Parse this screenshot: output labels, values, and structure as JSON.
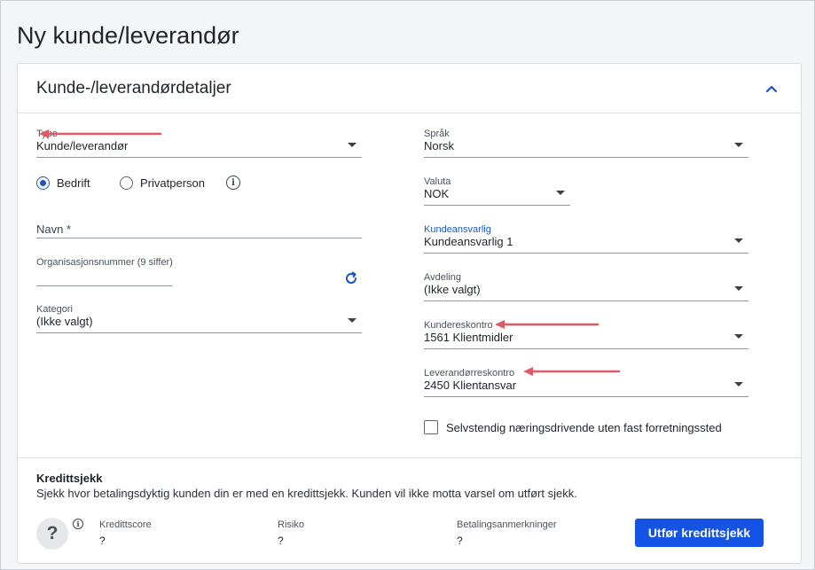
{
  "page": {
    "title": "Ny kunde/leverandør"
  },
  "card": {
    "title": "Kunde-/leverandørdetaljer"
  },
  "left": {
    "type": {
      "label": "Type",
      "value": "Kunde/leverandør"
    },
    "radios": [
      {
        "label": "Bedrift",
        "selected": true
      },
      {
        "label": "Privatperson",
        "selected": false
      }
    ],
    "navn": {
      "placeholder": "Navn *",
      "value": ""
    },
    "orgnr": {
      "label": "Organisasjonsnummer (9 siffer)",
      "value": ""
    },
    "kategori": {
      "label": "Kategori",
      "value": "(Ikke valgt)"
    }
  },
  "right": {
    "sprak": {
      "label": "Språk",
      "value": "Norsk"
    },
    "valuta": {
      "label": "Valuta",
      "value": "NOK"
    },
    "kundeansvarlig": {
      "label": "Kundeansvarlig",
      "value": "Kundeansvarlig 1"
    },
    "avdeling": {
      "label": "Avdeling",
      "value": "(Ikke valgt)"
    },
    "kundereskontro": {
      "label": "Kundereskontro",
      "value": "1561 Klientmidler"
    },
    "leverandorreskontro": {
      "label": "Leverandørreskontro",
      "value": "2450 Klientansvar"
    },
    "checkbox": {
      "label": "Selvstendig næringsdrivende uten fast forretningssted",
      "checked": false
    }
  },
  "credit": {
    "title": "Kredittsjekk",
    "description": "Sjekk hvor betalingsdyktig kunden din er med en kredittsjekk. Kunden vil ikke motta varsel om utført sjekk.",
    "icon_text": "?",
    "stats": [
      {
        "label": "Kredittscore",
        "value": "?"
      },
      {
        "label": "Risiko",
        "value": "?"
      },
      {
        "label": "Betalingsanmerkninger",
        "value": "?"
      }
    ],
    "button_label": "Utfør kredittsjekk"
  },
  "colors": {
    "accent": "#1453e4",
    "annotation_arrow": "#e05a66",
    "label_blue": "#1a56c9"
  }
}
